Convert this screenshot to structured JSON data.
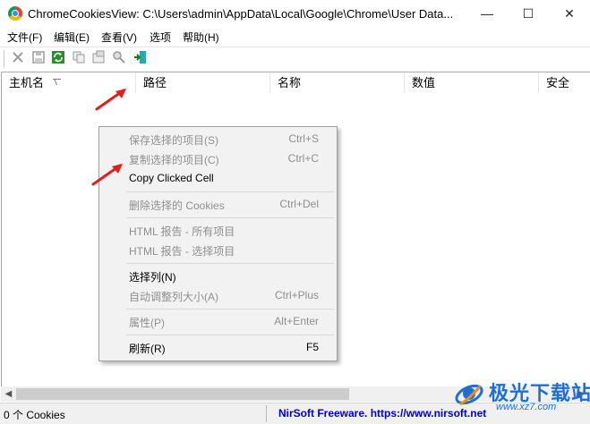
{
  "window": {
    "title": "ChromeCookiesView:  C:\\Users\\admin\\AppData\\Local\\Google\\Chrome\\User Data...",
    "minimize": "—",
    "maximize": "☐",
    "close": "✕"
  },
  "menu": [
    "文件(F)",
    "编辑(E)",
    "查看(V)",
    "选项",
    "帮助(H)"
  ],
  "toolbar": {
    "icons": [
      "delete-icon",
      "save-icon",
      "refresh-icon",
      "copy-icon",
      "properties-icon",
      "find-icon",
      "exit-icon"
    ]
  },
  "columns": [
    "主机名",
    "路径",
    "名称",
    "数值",
    "安全"
  ],
  "context_menu": {
    "items": [
      {
        "label": "保存选择的项目(S)",
        "shortcut": "Ctrl+S",
        "enabled": false
      },
      {
        "label": "复制选择的项目(C)",
        "shortcut": "Ctrl+C",
        "enabled": false
      },
      {
        "label": "Copy Clicked Cell",
        "shortcut": "",
        "enabled": true
      },
      {
        "label": "删除选择的 Cookies",
        "shortcut": "Ctrl+Del",
        "enabled": false
      },
      {
        "label": "HTML 报告 - 所有项目",
        "shortcut": "",
        "enabled": false
      },
      {
        "label": "HTML 报告 - 选择项目",
        "shortcut": "",
        "enabled": false
      },
      {
        "label": "选择列(N)",
        "shortcut": "",
        "enabled": true
      },
      {
        "label": "自动调整列大小(A)",
        "shortcut": "Ctrl+Plus",
        "enabled": false
      },
      {
        "label": "属性(P)",
        "shortcut": "Alt+Enter",
        "enabled": false
      },
      {
        "label": "刷新(R)",
        "shortcut": "F5",
        "enabled": true
      }
    ]
  },
  "statusbar": {
    "count": "0 个 Cookies",
    "link": "NirSoft Freeware. https://www.nirsoft.net"
  },
  "watermark": {
    "title": "极光下载站",
    "url": "www.xz7.com"
  },
  "colors": {
    "annotation_arrow": "#e0201c",
    "link": "#0000cc",
    "disabled_text": "#8f8f8f"
  }
}
